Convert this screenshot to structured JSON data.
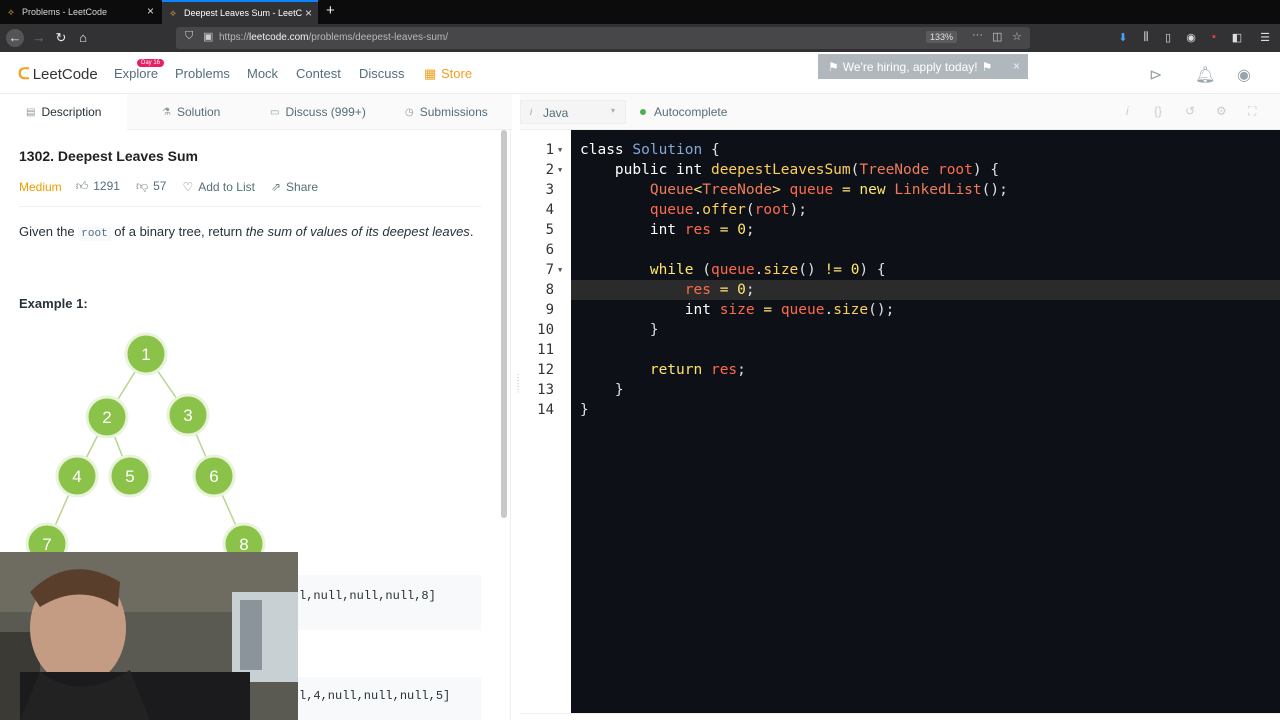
{
  "browser": {
    "tabs": [
      {
        "title": "Problems - LeetCode"
      },
      {
        "title": "Deepest Leaves Sum - LeetCode"
      }
    ],
    "url_prefix": "https://",
    "url_host": "leetcode.com",
    "url_path": "/problems/deepest-leaves-sum/",
    "zoom": "133%"
  },
  "site_nav": {
    "logo": "LeetCode",
    "links": [
      "Explore",
      "Problems",
      "Mock",
      "Contest",
      "Discuss",
      "Store"
    ],
    "explore_badge": "Day 16",
    "hiring_banner": "We're hiring, apply today!"
  },
  "description_tabs": [
    "Description",
    "Solution",
    "Discuss (999+)",
    "Submissions"
  ],
  "problem": {
    "title": "1302. Deepest Leaves Sum",
    "difficulty": "Medium",
    "likes": "1291",
    "dislikes": "57",
    "add_to_list": "Add to List",
    "share": "Share",
    "statement_pre": "Given the ",
    "statement_code": "root",
    "statement_mid": " of a binary tree, return ",
    "statement_em": "the sum of values of its deepest leaves",
    "statement_end": ".",
    "example_title": "Example 1:",
    "tree_nodes": [
      "1",
      "2",
      "3",
      "4",
      "5",
      "6",
      "7",
      "8"
    ],
    "example_output_1": "l,null,null,null,8]",
    "example_output_2": "l,4,null,null,null,5]"
  },
  "editor": {
    "language": "Java",
    "autocomplete": "Autocomplete",
    "line_numbers": [
      "1",
      "2",
      "3",
      "4",
      "5",
      "6",
      "7",
      "8",
      "9",
      "10",
      "11",
      "12",
      "13",
      "14"
    ],
    "highlighted_line": 8,
    "colors": {
      "background": "#0d1117",
      "keyword": "#ffe66d",
      "variable": "#ff6a4d",
      "type": "#f07b5a"
    }
  }
}
